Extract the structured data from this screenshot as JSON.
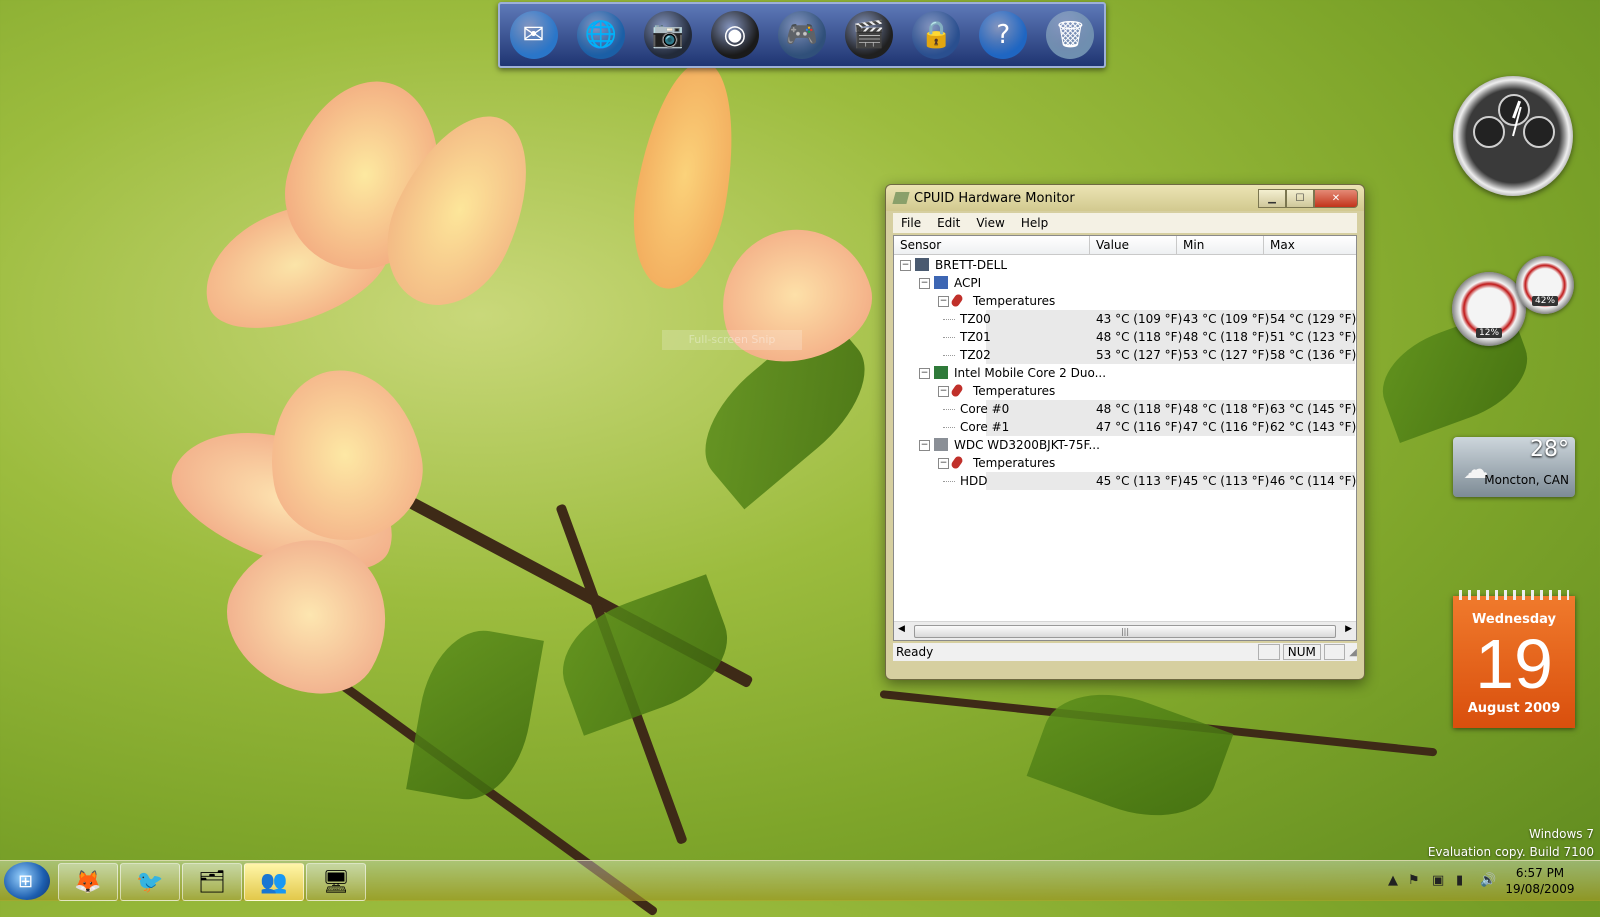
{
  "dock": {
    "items": [
      {
        "icon": "mail-icon",
        "glyph": "✉",
        "color": "#2a76c9"
      },
      {
        "icon": "globe-icon",
        "glyph": "🌐",
        "color": "#1b5fa6"
      },
      {
        "icon": "camera-icon",
        "glyph": "📷",
        "color": "#222a3a"
      },
      {
        "icon": "speaker-icon",
        "glyph": "◉",
        "color": "#1a1a1a"
      },
      {
        "icon": "games-icon",
        "glyph": "🎮",
        "color": "#30507a"
      },
      {
        "icon": "clapperboard-icon",
        "glyph": "🎬",
        "color": "#202020"
      },
      {
        "icon": "shield-lock-icon",
        "glyph": "🔒",
        "color": "#2a4f8f"
      },
      {
        "icon": "help-icon",
        "glyph": "?",
        "color": "#1f66c2"
      },
      {
        "icon": "recycle-bin-icon",
        "glyph": "🗑",
        "color": "#6f8fb0"
      }
    ]
  },
  "window": {
    "title": "CPUID Hardware Monitor",
    "menu": [
      "File",
      "Edit",
      "View",
      "Help"
    ],
    "columns": [
      "Sensor",
      "Value",
      "Min",
      "Max"
    ],
    "tree": [
      {
        "level": 0,
        "label": "BRETT-DELL",
        "type": "computer"
      },
      {
        "level": 1,
        "label": "ACPI",
        "type": "acpi"
      },
      {
        "level": 2,
        "label": "Temperatures",
        "type": "temps"
      },
      {
        "level": 3,
        "label": "TZ00",
        "type": "leaf",
        "value": "43 °C  (109 °F)",
        "min": "43 °C  (109 °F)",
        "max": "54 °C  (129 °F)"
      },
      {
        "level": 3,
        "label": "TZ01",
        "type": "leaf",
        "value": "48 °C  (118 °F)",
        "min": "48 °C  (118 °F)",
        "max": "51 °C  (123 °F)"
      },
      {
        "level": 3,
        "label": "TZ02",
        "type": "leaf",
        "value": "53 °C  (127 °F)",
        "min": "53 °C  (127 °F)",
        "max": "58 °C  (136 °F)"
      },
      {
        "level": 1,
        "label": "Intel Mobile Core 2 Duo...",
        "type": "cpu"
      },
      {
        "level": 2,
        "label": "Temperatures",
        "type": "temps"
      },
      {
        "level": 3,
        "label": "Core #0",
        "type": "leaf",
        "value": "48 °C  (118 °F)",
        "min": "48 °C  (118 °F)",
        "max": "63 °C  (145 °F)"
      },
      {
        "level": 3,
        "label": "Core #1",
        "type": "leaf",
        "value": "47 °C  (116 °F)",
        "min": "47 °C  (116 °F)",
        "max": "62 °C  (143 °F)"
      },
      {
        "level": 1,
        "label": "WDC WD3200BJKT-75F...",
        "type": "disk"
      },
      {
        "level": 2,
        "label": "Temperatures",
        "type": "temps"
      },
      {
        "level": 3,
        "label": "HDD",
        "type": "leaf",
        "value": "45 °C  (113 °F)",
        "min": "45 °C  (113 °F)",
        "max": "46 °C  (114 °F)"
      }
    ],
    "status": {
      "text": "Ready",
      "num": "NUM"
    }
  },
  "gadgets": {
    "meter": {
      "cpu": "12%",
      "memory": "42%"
    },
    "weather": {
      "temp": "28°",
      "city": "Moncton, CAN"
    },
    "calendar": {
      "weekday": "Wednesday",
      "day": "19",
      "month_year": "August 2009"
    }
  },
  "ghost_label": "Full-screen Snip",
  "watermark": {
    "line1": "Windows 7",
    "line2": "Evaluation copy. Build 7100"
  },
  "taskbar": {
    "buttons": [
      {
        "name": "firefox-button",
        "icon": "firefox-icon",
        "glyph": "🦊"
      },
      {
        "name": "app-button",
        "icon": "bird-icon",
        "glyph": "🐦"
      },
      {
        "name": "explorer-button",
        "icon": "folder-icon",
        "glyph": "🗂"
      },
      {
        "name": "messenger-button",
        "icon": "people-icon",
        "glyph": "👥"
      },
      {
        "name": "hwmonitor-button",
        "icon": "hwmonitor-icon",
        "glyph": "🖥"
      }
    ],
    "time": "6:57 PM",
    "date": "19/08/2009"
  },
  "colors": {
    "accent": "#e8632a",
    "window_frame": "#d6cfa0"
  }
}
